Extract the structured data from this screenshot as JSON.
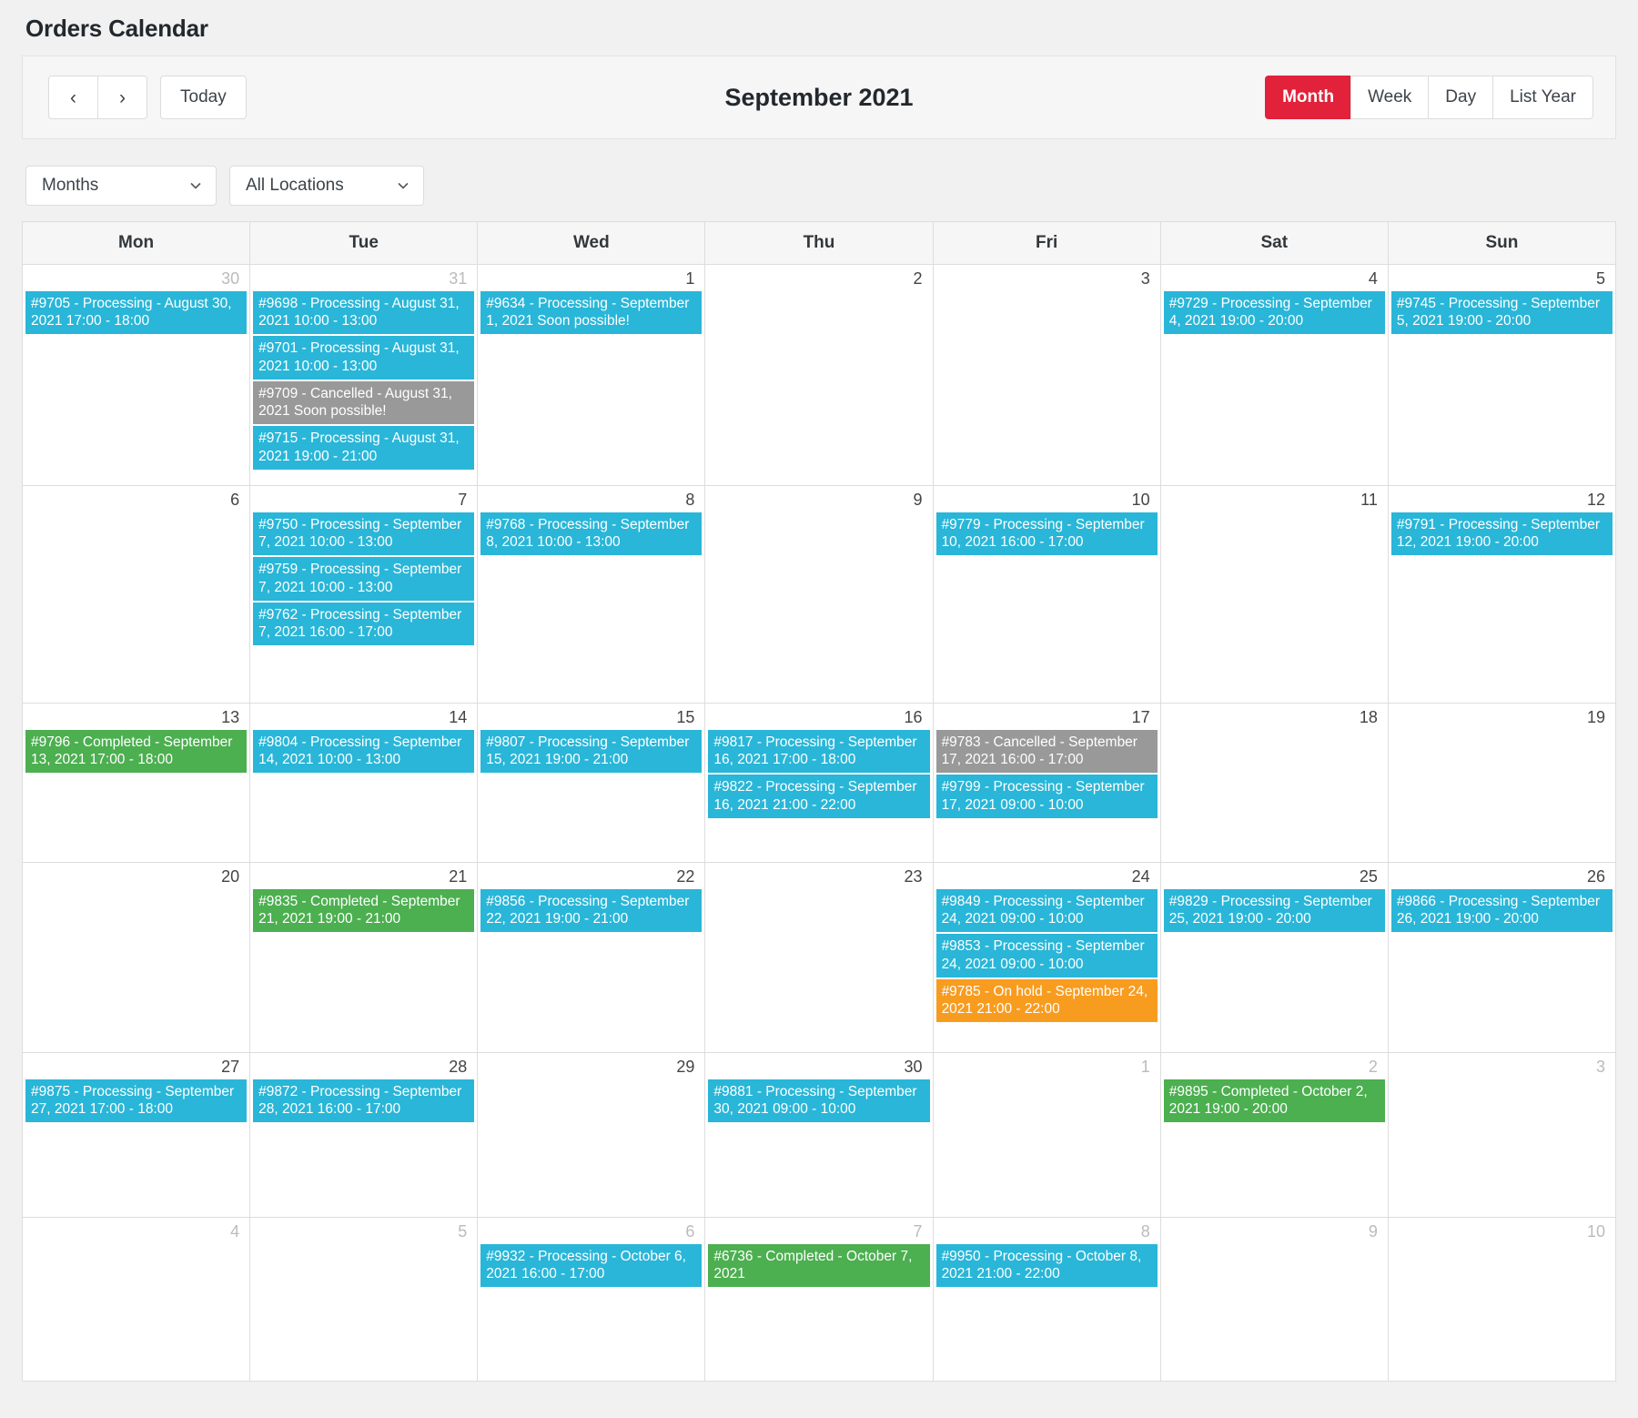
{
  "page": {
    "title": "Orders Calendar"
  },
  "toolbar": {
    "prev_label": "‹",
    "next_label": "›",
    "today_label": "Today",
    "calendar_title": "September 2021",
    "views": [
      {
        "label": "Month",
        "active": true
      },
      {
        "label": "Week",
        "active": false
      },
      {
        "label": "Day",
        "active": false
      },
      {
        "label": "List Year",
        "active": false
      }
    ],
    "active_view": "Month",
    "accent_color": "#e2213a"
  },
  "filters": {
    "period_select": {
      "value": "Months",
      "options": [
        "Months"
      ]
    },
    "location_select": {
      "value": "All Locations",
      "options": [
        "All Locations"
      ]
    }
  },
  "calendar": {
    "day_headers": [
      "Mon",
      "Tue",
      "Wed",
      "Thu",
      "Fri",
      "Sat",
      "Sun"
    ],
    "status_colors": {
      "processing": "#29b6d8",
      "completed": "#4caf50",
      "cancelled": "#999999",
      "onhold": "#f89c20"
    },
    "weeks": [
      [
        {
          "num": "30",
          "other": true,
          "events": [
            {
              "status": "processing",
              "text": "#9705 - Processing - August 30, 2021 17:00 - 18:00"
            }
          ]
        },
        {
          "num": "31",
          "other": true,
          "events": [
            {
              "status": "processing",
              "text": "#9698 - Processing - August 31, 2021 10:00 - 13:00"
            },
            {
              "status": "processing",
              "text": "#9701 - Processing - August 31, 2021 10:00 - 13:00"
            },
            {
              "status": "cancelled",
              "text": "#9709 - Cancelled - August 31, 2021 Soon possible!"
            },
            {
              "status": "processing",
              "text": "#9715 - Processing - August 31, 2021 19:00 - 21:00"
            }
          ]
        },
        {
          "num": "1",
          "other": false,
          "events": [
            {
              "status": "processing",
              "text": "#9634 - Processing - September 1, 2021 Soon possible!"
            }
          ]
        },
        {
          "num": "2",
          "other": false,
          "events": []
        },
        {
          "num": "3",
          "other": false,
          "events": []
        },
        {
          "num": "4",
          "other": false,
          "events": [
            {
              "status": "processing",
              "text": "#9729 - Processing - September 4, 2021 19:00 - 20:00"
            }
          ]
        },
        {
          "num": "5",
          "other": false,
          "events": [
            {
              "status": "processing",
              "text": "#9745 - Processing - September 5, 2021 19:00 - 20:00"
            }
          ]
        }
      ],
      [
        {
          "num": "6",
          "other": false,
          "events": []
        },
        {
          "num": "7",
          "other": false,
          "events": [
            {
              "status": "processing",
              "text": "#9750 - Processing - September 7, 2021 10:00 - 13:00"
            },
            {
              "status": "processing",
              "text": "#9759 - Processing - September 7, 2021 10:00 - 13:00"
            },
            {
              "status": "processing",
              "text": "#9762 - Processing - September 7, 2021 16:00 - 17:00"
            }
          ]
        },
        {
          "num": "8",
          "other": false,
          "events": [
            {
              "status": "processing",
              "text": "#9768 - Processing - September 8, 2021 10:00 - 13:00"
            }
          ]
        },
        {
          "num": "9",
          "other": false,
          "events": []
        },
        {
          "num": "10",
          "other": false,
          "events": [
            {
              "status": "processing",
              "text": "#9779 - Processing - September 10, 2021 16:00 - 17:00"
            }
          ]
        },
        {
          "num": "11",
          "other": false,
          "events": []
        },
        {
          "num": "12",
          "other": false,
          "events": [
            {
              "status": "processing",
              "text": "#9791 - Processing - September 12, 2021 19:00 - 20:00"
            }
          ]
        }
      ],
      [
        {
          "num": "13",
          "other": false,
          "events": [
            {
              "status": "completed",
              "text": "#9796 - Completed - September 13, 2021 17:00 - 18:00"
            }
          ]
        },
        {
          "num": "14",
          "other": false,
          "events": [
            {
              "status": "processing",
              "text": "#9804 - Processing - September 14, 2021 10:00 - 13:00"
            }
          ]
        },
        {
          "num": "15",
          "other": false,
          "events": [
            {
              "status": "processing",
              "text": "#9807 - Processing - September 15, 2021 19:00 - 21:00"
            }
          ]
        },
        {
          "num": "16",
          "other": false,
          "events": [
            {
              "status": "processing",
              "text": "#9817 - Processing - September 16, 2021 17:00 - 18:00"
            },
            {
              "status": "processing",
              "text": "#9822 - Processing - September 16, 2021 21:00 - 22:00"
            }
          ]
        },
        {
          "num": "17",
          "other": false,
          "events": [
            {
              "status": "cancelled",
              "text": "#9783 - Cancelled - September 17, 2021 16:00 - 17:00"
            },
            {
              "status": "processing",
              "text": "#9799 - Processing - September 17, 2021 09:00 - 10:00"
            }
          ]
        },
        {
          "num": "18",
          "other": false,
          "events": []
        },
        {
          "num": "19",
          "other": false,
          "events": []
        }
      ],
      [
        {
          "num": "20",
          "other": false,
          "events": []
        },
        {
          "num": "21",
          "other": false,
          "events": [
            {
              "status": "completed",
              "text": "#9835 - Completed - September 21, 2021 19:00 - 21:00"
            }
          ]
        },
        {
          "num": "22",
          "other": false,
          "events": [
            {
              "status": "processing",
              "text": "#9856 - Processing - September 22, 2021 19:00 - 21:00"
            }
          ]
        },
        {
          "num": "23",
          "other": false,
          "events": []
        },
        {
          "num": "24",
          "other": false,
          "events": [
            {
              "status": "processing",
              "text": "#9849 - Processing - September 24, 2021 09:00 - 10:00"
            },
            {
              "status": "processing",
              "text": "#9853 - Processing - September 24, 2021 09:00 - 10:00"
            },
            {
              "status": "onhold",
              "text": "#9785 - On hold - September 24, 2021 21:00 - 22:00"
            }
          ]
        },
        {
          "num": "25",
          "other": false,
          "events": [
            {
              "status": "processing",
              "text": "#9829 - Processing - September 25, 2021 19:00 - 20:00"
            }
          ]
        },
        {
          "num": "26",
          "other": false,
          "events": [
            {
              "status": "processing",
              "text": "#9866 - Processing - September 26, 2021 19:00 - 20:00"
            }
          ]
        }
      ],
      [
        {
          "num": "27",
          "other": false,
          "events": [
            {
              "status": "processing",
              "text": "#9875 - Processing - September 27, 2021 17:00 - 18:00"
            }
          ]
        },
        {
          "num": "28",
          "other": false,
          "events": [
            {
              "status": "processing",
              "text": "#9872 - Processing - September 28, 2021 16:00 - 17:00"
            }
          ]
        },
        {
          "num": "29",
          "other": false,
          "events": []
        },
        {
          "num": "30",
          "other": false,
          "events": [
            {
              "status": "processing",
              "text": "#9881 - Processing - September 30, 2021 09:00 - 10:00"
            }
          ]
        },
        {
          "num": "1",
          "other": true,
          "events": []
        },
        {
          "num": "2",
          "other": true,
          "events": [
            {
              "status": "completed",
              "text": "#9895 - Completed - October 2, 2021 19:00 - 20:00"
            }
          ]
        },
        {
          "num": "3",
          "other": true,
          "events": []
        }
      ],
      [
        {
          "num": "4",
          "other": true,
          "events": []
        },
        {
          "num": "5",
          "other": true,
          "events": []
        },
        {
          "num": "6",
          "other": true,
          "events": [
            {
              "status": "processing",
              "text": "#9932 - Processing - October 6, 2021 16:00 - 17:00"
            }
          ]
        },
        {
          "num": "7",
          "other": true,
          "events": [
            {
              "status": "completed",
              "text": "#6736 - Completed - October 7, 2021"
            }
          ]
        },
        {
          "num": "8",
          "other": true,
          "events": [
            {
              "status": "processing",
              "text": "#9950 - Processing - October 8, 2021 21:00 - 22:00"
            }
          ]
        },
        {
          "num": "9",
          "other": true,
          "events": []
        },
        {
          "num": "10",
          "other": true,
          "events": []
        }
      ]
    ]
  }
}
